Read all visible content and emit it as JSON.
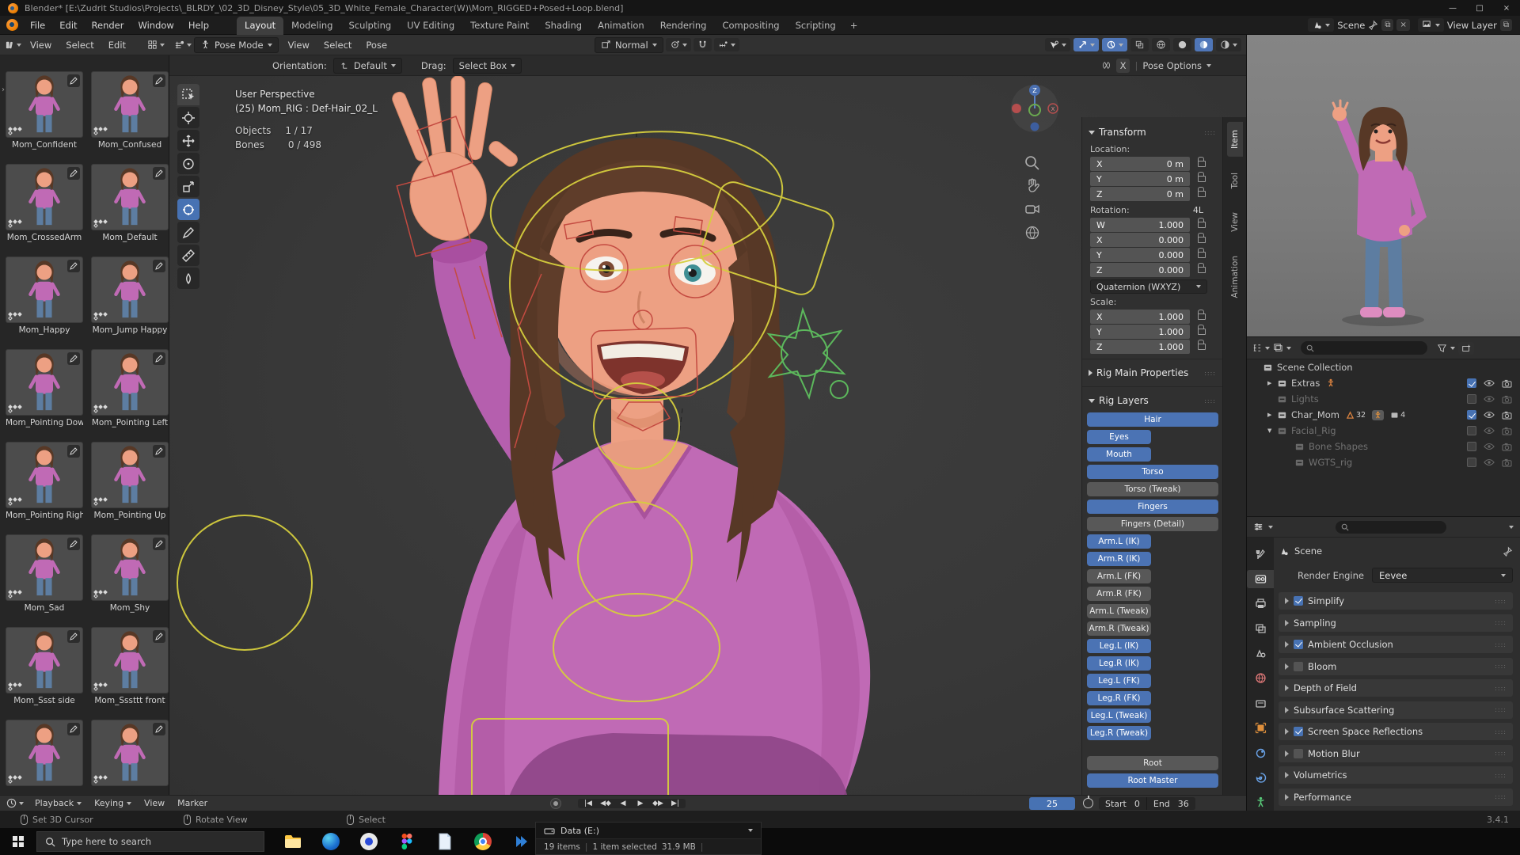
{
  "window": {
    "title": "Blender* [E:\\Zudrit Studios\\Projects\\_BLRDY_\\02_3D_Disney_Style\\05_3D_White_Female_Character(W)\\Mom_RIGGED+Posed+Loop.blend]",
    "minimize": "—",
    "maximize": "□",
    "close": "×"
  },
  "topbar": {
    "menus": [
      "File",
      "Edit",
      "Render",
      "Window",
      "Help"
    ],
    "workspaces": [
      {
        "label": "Layout",
        "active": true
      },
      {
        "label": "Modeling"
      },
      {
        "label": "Sculpting"
      },
      {
        "label": "UV Editing"
      },
      {
        "label": "Texture Paint"
      },
      {
        "label": "Shading"
      },
      {
        "label": "Animation"
      },
      {
        "label": "Rendering"
      },
      {
        "label": "Compositing"
      },
      {
        "label": "Scripting"
      }
    ],
    "add_workspace": "+",
    "scene": "Scene",
    "view_layer": "View Layer"
  },
  "asset_browser": {
    "menus": [
      "View",
      "Select",
      "Edit"
    ],
    "items": [
      {
        "name": "Mom_Confident"
      },
      {
        "name": "Mom_Confused"
      },
      {
        "name": "Mom_CrossedArm"
      },
      {
        "name": "Mom_Default"
      },
      {
        "name": "Mom_Happy"
      },
      {
        "name": "Mom_Jump Happy"
      },
      {
        "name": "Mom_Pointing Down"
      },
      {
        "name": "Mom_Pointing Left"
      },
      {
        "name": "Mom_Pointing Right"
      },
      {
        "name": "Mom_Pointing Up"
      },
      {
        "name": "Mom_Sad"
      },
      {
        "name": "Mom_Shy"
      },
      {
        "name": "Mom_Ssst side"
      },
      {
        "name": "Mom_Sssttt front"
      },
      {
        "name": ""
      },
      {
        "name": ""
      }
    ]
  },
  "viewport": {
    "mode": "Pose Mode",
    "menus": [
      "View",
      "Select",
      "Pose"
    ],
    "orientation": "Normal",
    "tool_settings": {
      "orientation_label": "Orientation:",
      "orientation_value": "Default",
      "drag_label": "Drag:",
      "drag_value": "Select Box",
      "mirror_x": "X",
      "pose_options": "Pose Options"
    },
    "overlay": {
      "perspective": "User Perspective",
      "active_item": "(25) Mom_RIG : Def-Hair_02_L",
      "objects_label": "Objects",
      "objects_value": "1 / 17",
      "bones_label": "Bones",
      "bones_value": "0 / 498"
    }
  },
  "sidebar": {
    "tabs": [
      {
        "label": "Item",
        "active": true
      },
      {
        "label": "Tool"
      },
      {
        "label": "View"
      },
      {
        "label": "Animation"
      }
    ],
    "transform_title": "Transform",
    "location_label": "Location:",
    "location": [
      {
        "k": "X",
        "v": "0 m"
      },
      {
        "k": "Y",
        "v": "0 m"
      },
      {
        "k": "Z",
        "v": "0 m"
      }
    ],
    "rotation_label": "Rotation:",
    "rotation_badge": "4L",
    "rotation": [
      {
        "k": "W",
        "v": "1.000"
      },
      {
        "k": "X",
        "v": "0.000"
      },
      {
        "k": "Y",
        "v": "0.000"
      },
      {
        "k": "Z",
        "v": "0.000"
      }
    ],
    "rotation_mode": "Quaternion (WXYZ)",
    "scale_label": "Scale:",
    "scale": [
      {
        "k": "X",
        "v": "1.000"
      },
      {
        "k": "Y",
        "v": "1.000"
      },
      {
        "k": "Z",
        "v": "1.000"
      }
    ],
    "rig_main_properties": "Rig Main Properties",
    "rig_layers_title": "Rig Layers",
    "rig_buttons": [
      {
        "label": "Hair",
        "on": true
      },
      {
        "label": "Eyes",
        "on": true,
        "half": true
      },
      {
        "label": "Mouth",
        "on": true,
        "half": true
      },
      {
        "label": "Torso",
        "on": true
      },
      {
        "label": "Torso (Tweak)"
      },
      {
        "label": "Fingers",
        "on": true
      },
      {
        "label": "Fingers (Detail)"
      },
      {
        "label": "Arm.L (IK)",
        "on": true,
        "half": true
      },
      {
        "label": "Arm.R (IK)",
        "on": true,
        "half": true
      },
      {
        "label": "Arm.L (FK)",
        "half": true
      },
      {
        "label": "Arm.R (FK)",
        "half": true
      },
      {
        "label": "Arm.L (Tweak)",
        "half": true
      },
      {
        "label": "Arm.R (Tweak)",
        "half": true
      },
      {
        "label": "Leg.L (IK)",
        "on": true,
        "half": true
      },
      {
        "label": "Leg.R (IK)",
        "on": true,
        "half": true
      },
      {
        "label": "Leg.L (FK)",
        "on": true,
        "half": true
      },
      {
        "label": "Leg.R (FK)",
        "on": true,
        "half": true
      },
      {
        "label": "Leg.L (Tweak)",
        "on": true,
        "half": true
      },
      {
        "label": "Leg.R (Tweak)",
        "on": true,
        "half": true
      },
      {
        "label": "Root",
        "gap": true
      },
      {
        "label": "Root Master",
        "on": true
      }
    ]
  },
  "outliner": {
    "rows": [
      {
        "label": "Scene Collection",
        "arrow": ""
      },
      {
        "label": "Extras",
        "arrow": "▶",
        "ind1": true,
        "hasCheck": true,
        "checked": true,
        "arm": true
      },
      {
        "label": "Lights",
        "arrow": "",
        "ind1": true,
        "dim": true,
        "hasCheck": true
      },
      {
        "label": "Char_Mom",
        "arrow": "▶",
        "ind1": true,
        "hasCheck": true,
        "checked": true,
        "meshCount": "32",
        "collCount": "4",
        "armSel": true
      },
      {
        "label": "Facial_Rig",
        "arrow": "▼",
        "ind1": true,
        "dim": true,
        "hasCheck": true
      },
      {
        "label": "Bone Shapes",
        "arrow": "",
        "ind2": true,
        "dim": true,
        "hasCheck": true
      },
      {
        "label": "WGTS_rig",
        "arrow": "",
        "ind2": true,
        "dim": true,
        "hasCheck": true
      }
    ]
  },
  "properties": {
    "breadcrumb": "Scene",
    "render_engine_label": "Render Engine",
    "render_engine": "Eevee",
    "panels": [
      {
        "label": "Simplify",
        "hasCheck": true,
        "checked": true
      },
      {
        "label": "Sampling"
      },
      {
        "label": "Ambient Occlusion",
        "hasCheck": true,
        "checked": true
      },
      {
        "label": "Bloom",
        "hasCheck": true
      },
      {
        "label": "Depth of Field"
      },
      {
        "label": "Subsurface Scattering"
      },
      {
        "label": "Screen Space Reflections",
        "hasCheck": true,
        "checked": true
      },
      {
        "label": "Motion Blur",
        "hasCheck": true
      },
      {
        "label": "Volumetrics"
      },
      {
        "label": "Performance"
      }
    ]
  },
  "timeline": {
    "menus": [
      {
        "label": "Playback",
        "dd": true
      },
      {
        "label": "Keying",
        "dd": true
      },
      {
        "label": "View"
      },
      {
        "label": "Marker"
      }
    ],
    "current_frame": "25",
    "start_label": "Start",
    "start_value": "0",
    "end_label": "End",
    "end_value": "36"
  },
  "statusbar": {
    "hints": [
      {
        "label": "Set 3D Cursor"
      },
      {
        "label": "Rotate View"
      },
      {
        "label": "Select"
      }
    ],
    "version": "3.4.1"
  },
  "taskbar": {
    "search_placeholder": "Type here to search",
    "explorer_title": "Data (E:)",
    "explorer_items": "19 items",
    "explorer_selected": "1 item selected",
    "explorer_size": "31.9 MB"
  },
  "colors": {
    "accent_blue": "#4772b3",
    "rig_button_blue": "#4b73b4",
    "blender_orange": "#e87d02"
  }
}
